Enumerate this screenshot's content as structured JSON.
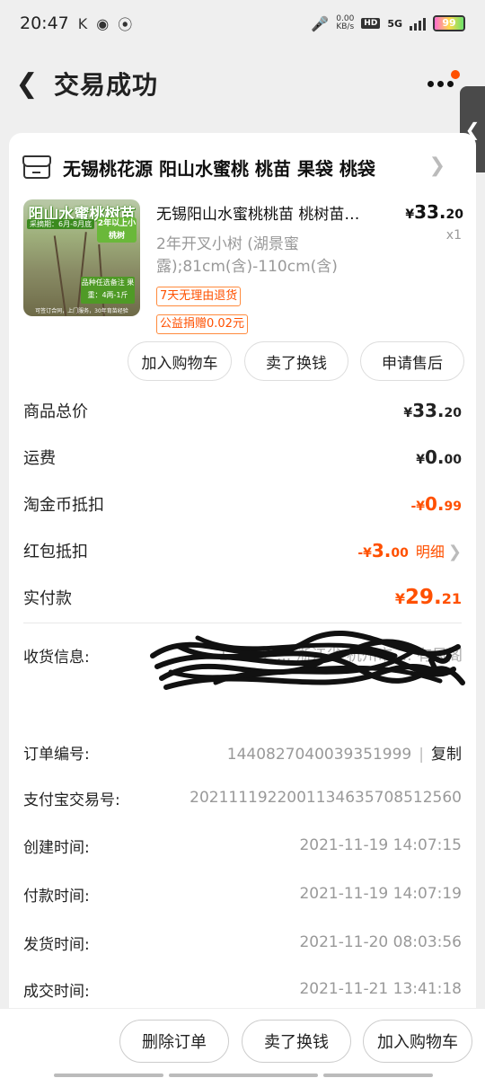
{
  "status_bar": {
    "time": "20:47",
    "carrier_icon": "K",
    "net_speed_value": "0.00",
    "net_speed_unit": "KB/s",
    "hd": "HD",
    "net_type": "5G",
    "battery_level": "99"
  },
  "header": {
    "title": "交易成功"
  },
  "shop": {
    "name": "无锡桃花源  阳山水蜜桃 桃苗 果袋 桃袋"
  },
  "product": {
    "name": "无锡阳山水蜜桃桃苗 桃树苗…",
    "price_symbol": "¥",
    "price_int": "33.",
    "price_dec": "20",
    "quantity": "x1",
    "sku": "2年开叉小树 (湖景蜜露);81cm(含)-110cm(含)",
    "tag_return": "7天无理由退货",
    "tag_charity": "公益捐赠0.02元",
    "image": {
      "title": "阳山水蜜桃树苗",
      "sub": "采摘期：6月-8月底",
      "badge": "2年以上小桃树",
      "box": "品种任选备注 果重：4两-1斤",
      "bottom": "可签订合同，上门服务，30年育苗经验"
    }
  },
  "actions": {
    "add_cart": "加入购物车",
    "sell": "卖了换钱",
    "after_sale": "申请售后"
  },
  "fees": {
    "total_label": "商品总价",
    "total_sym": "¥",
    "total_int": "33.",
    "total_dec": "20",
    "shipping_label": "运费",
    "shipping_sym": "¥",
    "shipping_int": "0.",
    "shipping_dec": "00",
    "coin_label": "淘金币抵扣",
    "coin_sym": "-¥",
    "coin_int": "0.",
    "coin_dec": "99",
    "redpacket_label": "红包抵扣",
    "redpacket_sym": "-¥",
    "redpacket_int": "3.",
    "redpacket_dec": "00",
    "redpacket_detail": "明细",
    "paid_label": "实付款",
    "paid_sym": "¥",
    "paid_int": "29.",
    "paid_dec": "21"
  },
  "order_info": {
    "receiver_label": "收货信息:",
    "receiver_value": "1 ... 72 ... 浙江省 杭州市 ... 有风阁",
    "order_no_label": "订单编号:",
    "order_no": "1440827040039351999",
    "copy_label": "复制",
    "alipay_label": "支付宝交易号:",
    "alipay_no": "2021111922001134635708512560",
    "created_label": "创建时间:",
    "created_time": "2021-11-19 14:07:15",
    "paid_time_label": "付款时间:",
    "paid_time": "2021-11-19 14:07:19",
    "shipped_label": "发货时间:",
    "shipped_time": "2021-11-20 08:03:56",
    "completed_label": "成交时间:",
    "completed_time": "2021-11-21 13:41:18"
  },
  "bottom_bar": {
    "delete": "删除订单",
    "sell": "卖了换钱",
    "add_cart": "加入购物车"
  }
}
